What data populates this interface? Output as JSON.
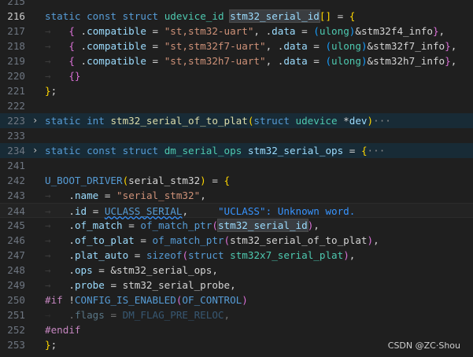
{
  "lines": [
    {
      "num": "215",
      "html": ""
    },
    {
      "num": "216",
      "cur": true,
      "html": "<span class=\"kw\">static</span> <span class=\"kw\">const</span> <span class=\"kw\">struct</span> <span class=\"ty\">udevice_id</span> <span class=\"id match\">stm32_serial_id</span><span class=\"b1\">[]</span> = <span class=\"b1\">{</span>"
    },
    {
      "num": "217",
      "html": "<span class=\"ws\">→</span>   <span class=\"b2\">{</span> .<span class=\"id\">compatible</span> = <span class=\"str\">\"st,stm32-uart\"</span>, .<span class=\"id\">data</span> = <span class=\"b3\">(</span><span class=\"ty\">ulong</span><span class=\"b3\">)</span>&amp;stm32f4_info<span class=\"b2\">}</span>,"
    },
    {
      "num": "218",
      "html": "<span class=\"ws\">→</span>   <span class=\"b2\">{</span> .<span class=\"id\">compatible</span> = <span class=\"str\">\"st,stm32f7-uart\"</span>, .<span class=\"id\">data</span> = <span class=\"b3\">(</span><span class=\"ty\">ulong</span><span class=\"b3\">)</span>&amp;stm32f7_info<span class=\"b2\">}</span>,"
    },
    {
      "num": "219",
      "html": "<span class=\"ws\">→</span>   <span class=\"b2\">{</span> .<span class=\"id\">compatible</span> = <span class=\"str\">\"st,stm32h7-uart\"</span>, .<span class=\"id\">data</span> = <span class=\"b3\">(</span><span class=\"ty\">ulong</span><span class=\"b3\">)</span>&amp;stm32h7_info<span class=\"b2\">}</span>,"
    },
    {
      "num": "220",
      "html": "<span class=\"ws\">→</span>   <span class=\"b2\">{}</span>"
    },
    {
      "num": "221",
      "html": "<span class=\"b1\">}</span>;"
    },
    {
      "num": "222",
      "html": ""
    },
    {
      "num": "223",
      "fold": true,
      "hl": true,
      "html": "<span class=\"kw\">static</span> <span class=\"kw\">int</span> <span class=\"fn\">stm32_serial_of_to_plat</span><span class=\"b1\">(</span><span class=\"kw\">struct</span> <span class=\"ty\">udevice</span> *<span class=\"id\">dev</span><span class=\"b1\">)</span><span class=\"ell\">···</span>"
    },
    {
      "num": "233",
      "html": ""
    },
    {
      "num": "234",
      "fold": true,
      "hl": true,
      "html": "<span class=\"kw\">static</span> <span class=\"kw\">const</span> <span class=\"kw\">struct</span> <span class=\"ty\">dm_serial_ops</span> <span class=\"id\">stm32_serial_ops</span> = <span class=\"b1\">{</span><span class=\"ell\">···</span>"
    },
    {
      "num": "241",
      "html": ""
    },
    {
      "num": "242",
      "html": "<span class=\"mac\">U_BOOT_DRIVER</span><span class=\"b1\">(</span>serial_stm32<span class=\"b1\">)</span> = <span class=\"b1\">{</span>"
    },
    {
      "num": "243",
      "html": "<span class=\"ws\">→</span>   .<span class=\"id\">name</span> = <span class=\"str\">\"serial_stm32\"</span>,"
    },
    {
      "num": "244",
      "curline": true,
      "html": "<span class=\"ws\">→</span>   .<span class=\"id\">id</span> = <span class=\"mac squig\">UCLASS_SERIAL</span>,     <span class=\"diag\">\"UCLASS\": Unknown word.</span>"
    },
    {
      "num": "245",
      "html": "<span class=\"ws\">→</span>   .<span class=\"id\">of_match</span> = <span class=\"mac\">of_match_ptr</span><span class=\"b2\">(</span><span class=\"id match\">stm32_serial_id</span><span class=\"b2\">)</span>,"
    },
    {
      "num": "246",
      "html": "<span class=\"ws\">→</span>   .<span class=\"id\">of_to_plat</span> = <span class=\"mac\">of_match_ptr</span><span class=\"b2\">(</span>stm32_serial_of_to_plat<span class=\"b2\">)</span>,"
    },
    {
      "num": "247",
      "html": "<span class=\"ws\">→</span>   .<span class=\"id\">plat_auto</span> = <span class=\"kw\">sizeof</span><span class=\"b2\">(</span><span class=\"kw\">struct</span> <span class=\"ty\">stm32x7_serial_plat</span><span class=\"b2\">)</span>,"
    },
    {
      "num": "248",
      "html": "<span class=\"ws\">→</span>   .<span class=\"id\">ops</span> = &amp;stm32_serial_ops,"
    },
    {
      "num": "249",
      "html": "<span class=\"ws\">→</span>   .<span class=\"id\">probe</span> = stm32_serial_probe,"
    },
    {
      "num": "250",
      "html": "<span class=\"pp\">#if</span> !<span class=\"mac\">CONFIG_IS_ENABLED</span><span class=\"b2\">(</span><span class=\"mac\">OF_CONTROL</span><span class=\"b2\">)</span>"
    },
    {
      "num": "251",
      "html": "<span class=\"dim\"><span class=\"ws\">→</span>   .<span class=\"id\">flags</span> = <span class=\"mac\">DM_FLAG_PRE_RELOC</span>,</span>"
    },
    {
      "num": "252",
      "html": "<span class=\"pp\">#endif</span>"
    },
    {
      "num": "253",
      "html": "<span class=\"b1\">}</span>;"
    }
  ],
  "watermark": "CSDN @ZC·Shou",
  "fold_icon": "chevron-right-icon"
}
